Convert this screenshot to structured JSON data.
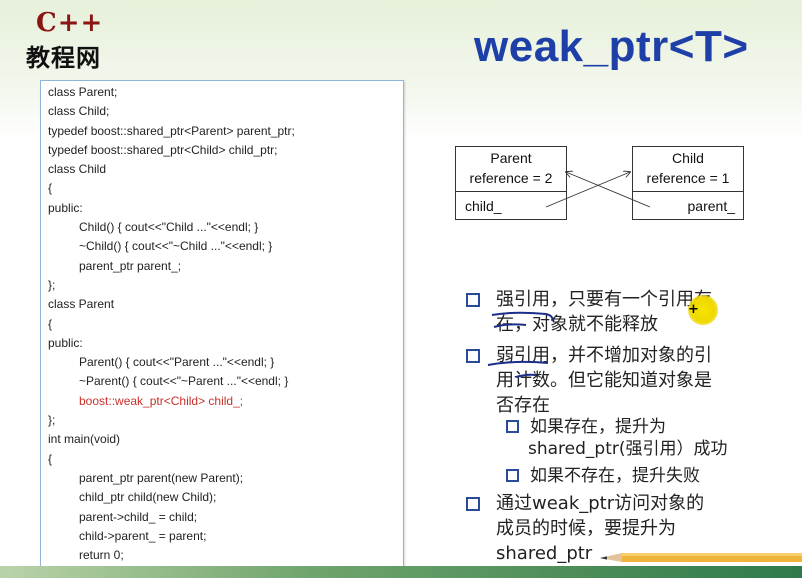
{
  "logo": {
    "line1": "C++",
    "line2": "教程网"
  },
  "title": "weak_ptr<T>",
  "code": [
    {
      "text": "class Parent;",
      "indent": 0,
      "highlight": false
    },
    {
      "text": "class Child;",
      "indent": 0,
      "highlight": false
    },
    {
      "text": "typedef boost::shared_ptr<Parent> parent_ptr;",
      "indent": 0,
      "highlight": false
    },
    {
      "text": "typedef boost::shared_ptr<Child> child_ptr;",
      "indent": 0,
      "highlight": false
    },
    {
      "text": "class Child",
      "indent": 0,
      "highlight": false
    },
    {
      "text": "{",
      "indent": 0,
      "highlight": false
    },
    {
      "text": "public:",
      "indent": 0,
      "highlight": false
    },
    {
      "text": "Child() { cout<<\"Child ...\"<<endl; }",
      "indent": 1,
      "highlight": false
    },
    {
      "text": "~Child() { cout<<\"~Child ...\"<<endl; }",
      "indent": 1,
      "highlight": false
    },
    {
      "text": "parent_ptr parent_;",
      "indent": 1,
      "highlight": false
    },
    {
      "text": "};",
      "indent": 0,
      "highlight": false
    },
    {
      "text": "class Parent",
      "indent": 0,
      "highlight": false
    },
    {
      "text": "{",
      "indent": 0,
      "highlight": false
    },
    {
      "text": "public:",
      "indent": 0,
      "highlight": false
    },
    {
      "text": "Parent() { cout<<\"Parent ...\"<<endl; }",
      "indent": 1,
      "highlight": false
    },
    {
      "text": "~Parent() { cout<<\"~Parent ...\"<<endl; }",
      "indent": 1,
      "highlight": false
    },
    {
      "text": "boost::weak_ptr<Child> child_;",
      "indent": 1,
      "highlight": true
    },
    {
      "text": "};",
      "indent": 0,
      "highlight": false
    },
    {
      "text": "int main(void)",
      "indent": 0,
      "highlight": false
    },
    {
      "text": "{",
      "indent": 0,
      "highlight": false
    },
    {
      "text": "parent_ptr parent(new Parent);",
      "indent": 1,
      "highlight": false
    },
    {
      "text": "child_ptr child(new Child);",
      "indent": 1,
      "highlight": false
    },
    {
      "text": "parent->child_ = child;",
      "indent": 1,
      "highlight": false
    },
    {
      "text": "child->parent_ = parent;",
      "indent": 1,
      "highlight": false
    },
    {
      "text": "return 0;",
      "indent": 1,
      "highlight": false
    },
    {
      "text": "}",
      "indent": 0,
      "highlight": false
    }
  ],
  "diagram": {
    "parent": {
      "name": "Parent",
      "ref": "reference = 2",
      "field": "child_"
    },
    "child": {
      "name": "Child",
      "ref": "reference = 1",
      "field": "parent_"
    }
  },
  "bullets": {
    "b1_l1": "强引用，只要有一个引用存",
    "b1_l2": "在，对象就不能释放",
    "b2_l1": "弱引用，并不增加对象的引",
    "b2_l2": "用计数。但它能知道对象是",
    "b2_l3": "否存在",
    "s1_l1": "如果存在，提升为",
    "s1_l2": "shared_ptr(强引用）成功",
    "s2_l1": "如果不存在，提升失败",
    "b3_l1": "通过weak_ptr访问对象的",
    "b3_l2": "成员的时候，要提升为",
    "b3_l3": "shared_ptr"
  },
  "colors": {
    "title": "#1f3fa8",
    "highlight_code": "#c8302a",
    "logo_red": "#8b1512",
    "bullet_square": "#2a4b9a",
    "pointer_highlight": "#f0d800"
  }
}
